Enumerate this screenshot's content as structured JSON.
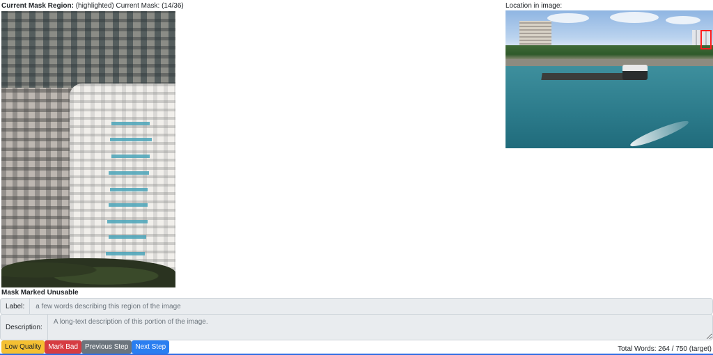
{
  "header": {
    "mask_region_label": "Current Mask Region:",
    "mask_region_text": "(highlighted) Current Mask: (14/36)",
    "location_label": "Location in image:"
  },
  "status": {
    "mask_status": "Mask Marked Unusable"
  },
  "form": {
    "label_prefix": "Label:",
    "label_placeholder": "a few words describing this region of the image",
    "label_value": "",
    "description_prefix": "Description:",
    "description_placeholder": "A long-text description of this portion of the image.",
    "description_value": ""
  },
  "buttons": {
    "low_quality": "Low Quality",
    "mark_bad": "Mark Bad",
    "previous_step": "Previous Step",
    "next_step": "Next Step"
  },
  "footer": {
    "total_words": "Total Words: 264 / 750 (target)"
  },
  "colors": {
    "highlight_box": "#ff1e1e",
    "warning": "#f5c032",
    "danger": "#d63c42",
    "secondary": "#6c757d",
    "primary": "#2a7ef0"
  }
}
